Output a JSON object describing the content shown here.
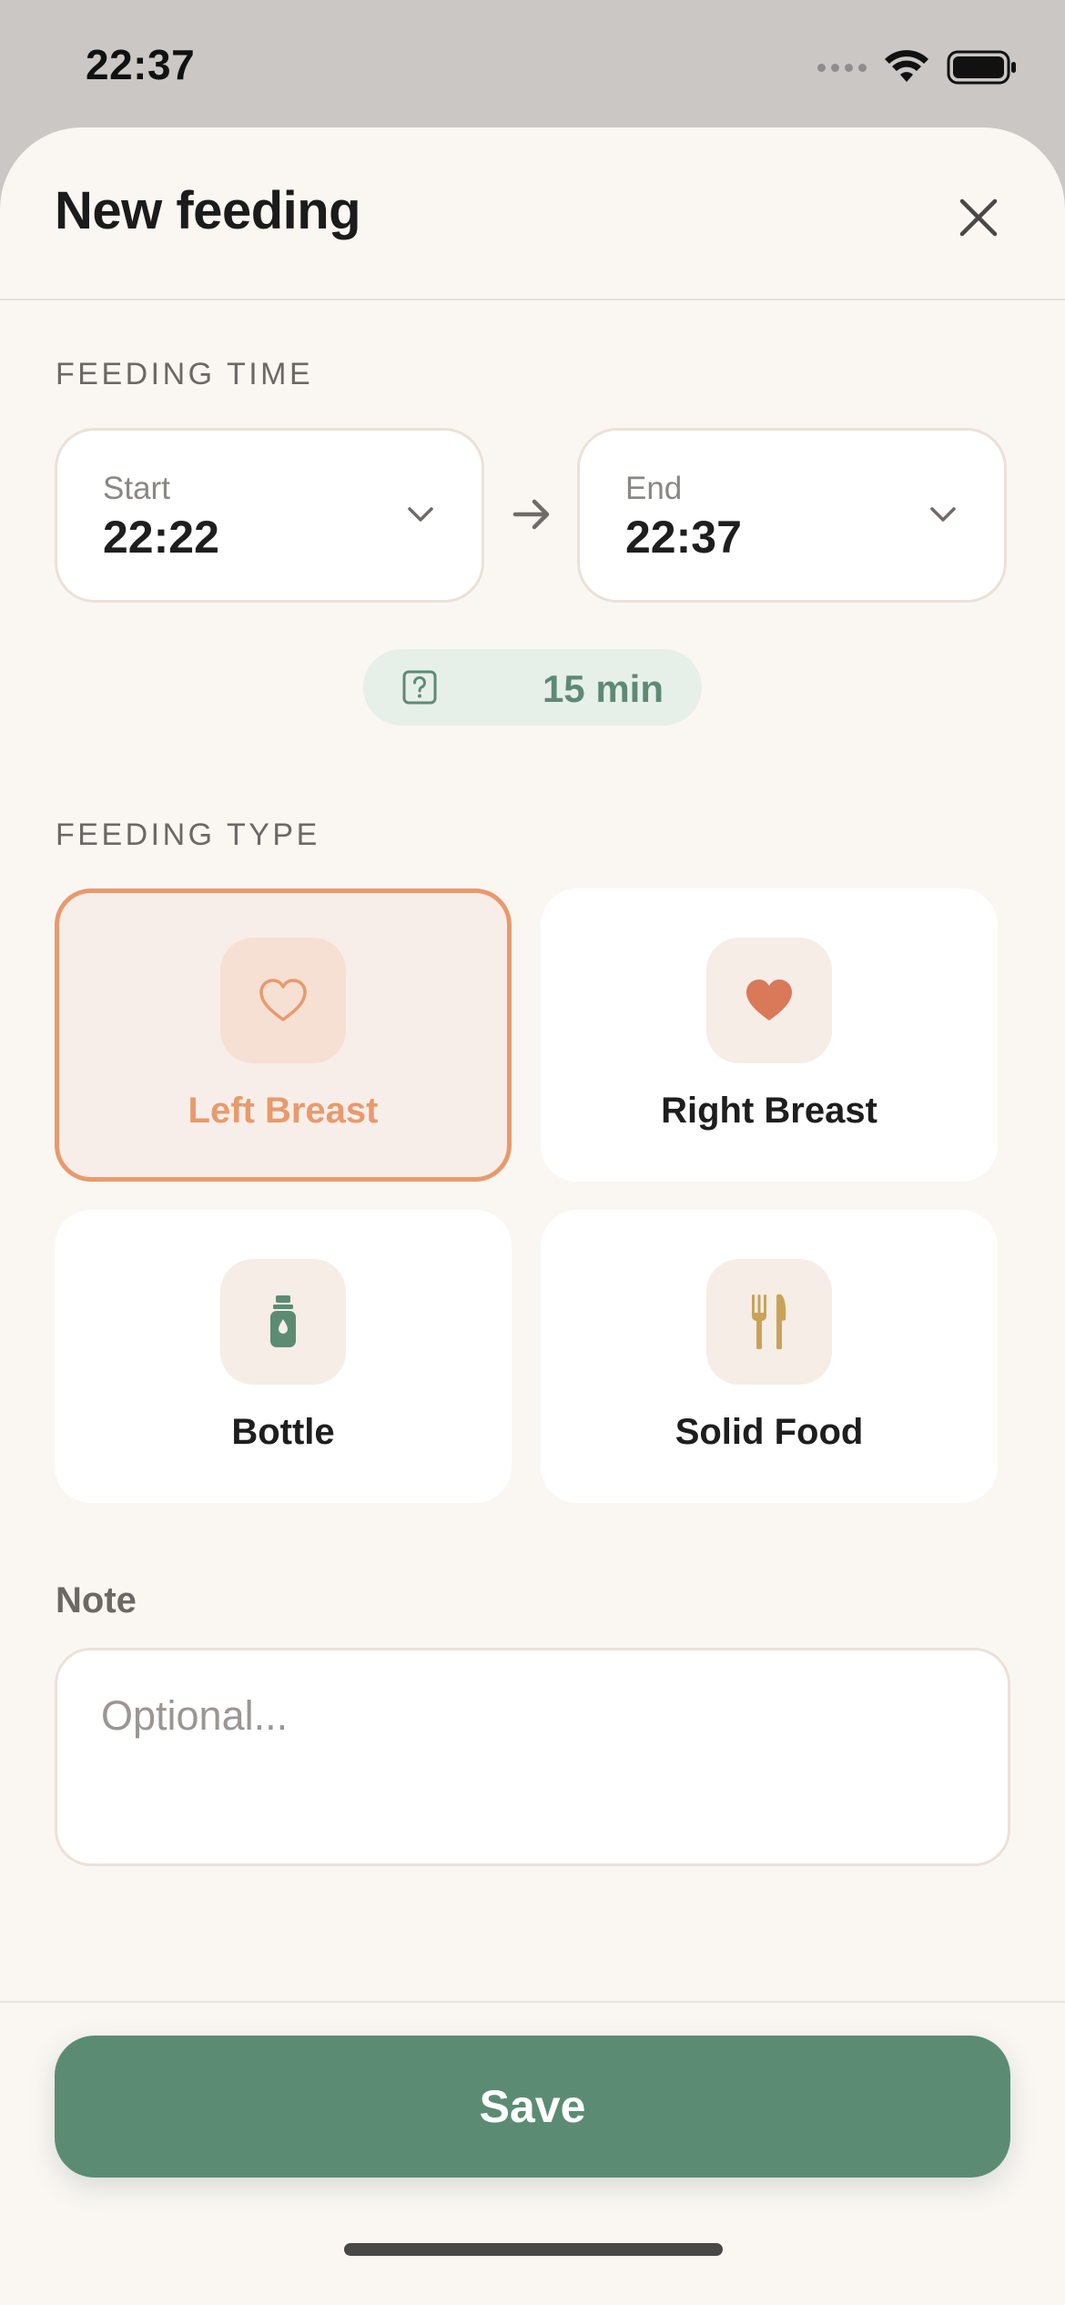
{
  "status_bar": {
    "time": "22:37"
  },
  "sheet": {
    "title": "New feeding"
  },
  "feeding_time": {
    "section_label": "FEEDING TIME",
    "start_label": "Start",
    "start_value": "22:22",
    "end_label": "End",
    "end_value": "22:37",
    "duration": "15 min"
  },
  "feeding_type": {
    "section_label": "FEEDING TYPE",
    "options": [
      {
        "label": "Left Breast",
        "icon": "heart-outline-icon",
        "selected": true
      },
      {
        "label": "Right Breast",
        "icon": "heart-filled-icon",
        "selected": false
      },
      {
        "label": "Bottle",
        "icon": "bottle-icon",
        "selected": false
      },
      {
        "label": "Solid Food",
        "icon": "fork-knife-icon",
        "selected": false
      }
    ]
  },
  "note": {
    "label": "Note",
    "placeholder": "Optional...",
    "value": ""
  },
  "actions": {
    "save_label": "Save"
  },
  "colors": {
    "accent_green": "#5c8b74",
    "selected_orange": "#e89a6d",
    "heart_red": "#d9795a",
    "bottle_green": "#5c8b74",
    "utensil_gold": "#c9a25a",
    "sheet_background": "#faf7f3"
  }
}
